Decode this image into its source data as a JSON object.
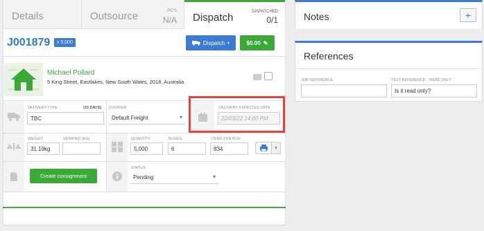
{
  "tabs": {
    "details": "Details",
    "outsource": "Outsource",
    "outsource_pos_label": "PO'S",
    "outsource_pos_value": "N/A",
    "dispatch": "Dispatch",
    "dispatched_label": "DISPATCHED",
    "dispatched_value": "0/1"
  },
  "job": {
    "number": "J001879",
    "qty_badge": "x 5,000",
    "dispatch_button": "Dispatch",
    "price_button": "$0.00"
  },
  "customer": {
    "name": "Michael Pollard",
    "address": "5 King Street, Eastlakes, New South Wales, 2018, Australia"
  },
  "delivery": {
    "type_label": "DELIVERY TYPE",
    "type_days": "(10 DAYS)",
    "type_value": "TBC",
    "courier_label": "COURIER",
    "courier_value": "Default Freight",
    "expected_label": "DELIVERY EXPECTED DATE",
    "expected_value": "22/03/22 14:00 PM"
  },
  "measures": {
    "weight_label": "WEIGHT",
    "weight_value": "31.19kg",
    "verified_label": "VERIFIED (KG)",
    "verified_value": "",
    "quantity_label": "QUANTITY",
    "quantity_value": "5,000",
    "boxes_label": "BOXES",
    "boxes_value": "6",
    "items_label": "ITEMS PER BOX",
    "items_value": "834"
  },
  "consignment": {
    "button": "Create consignment",
    "status_label": "STATUS",
    "status_value": "Pending"
  },
  "notes": {
    "title": "Notes",
    "add": "+"
  },
  "references": {
    "title": "References",
    "job_ref_label": "JOB REFERENCE",
    "job_ref_value": "",
    "test_ref_label": "TEST REFERENCE - 'READ ONLY'",
    "test_ref_value": "Is it read only?"
  },
  "colors": {
    "green": "#3aa935",
    "blue": "#3b7bd1",
    "highlight": "#e2433b"
  }
}
